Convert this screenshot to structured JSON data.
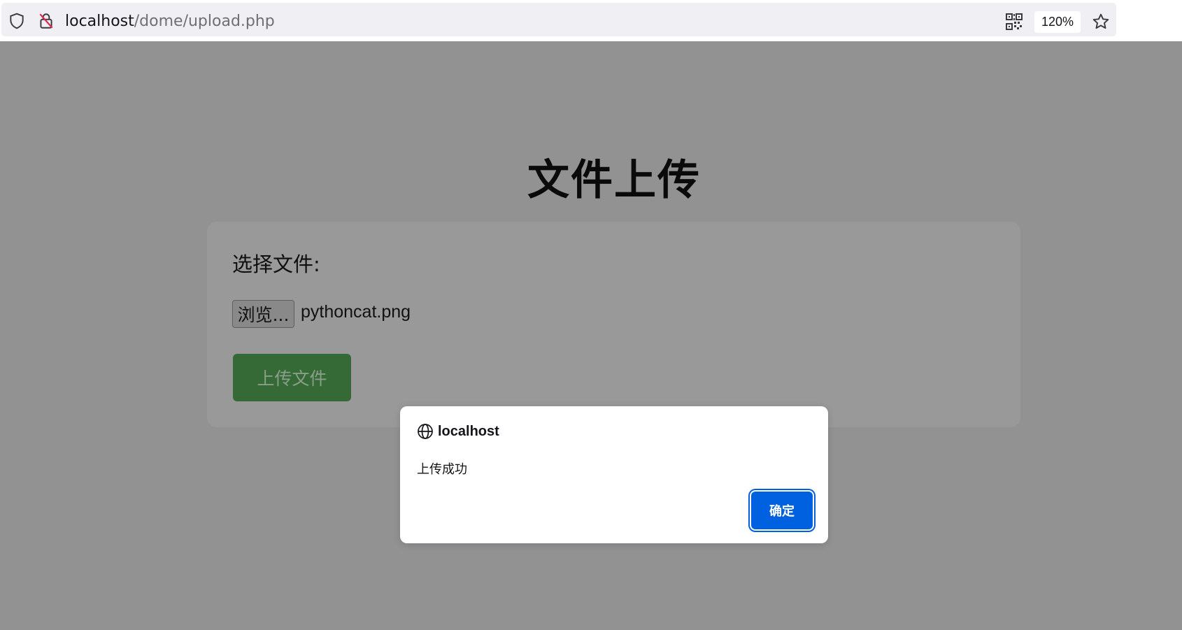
{
  "browser": {
    "url_host": "localhost",
    "url_path": "/dome/upload.php",
    "zoom": "120%",
    "icons": [
      "shield-icon",
      "insecure-lock-icon",
      "qr-code-icon",
      "bookmark-star-icon"
    ]
  },
  "page": {
    "title": "文件上传",
    "file_label": "选择文件:",
    "browse_button": "浏览...",
    "file_name": "pythoncat.png",
    "upload_button": "上传文件"
  },
  "dialog": {
    "origin": "localhost",
    "message": "上传成功",
    "ok_button": "确定",
    "icon": "globe-icon"
  },
  "colors": {
    "overlay_background": "#929293",
    "upload_button": "#356936",
    "dialog_button": "#0061e0"
  }
}
